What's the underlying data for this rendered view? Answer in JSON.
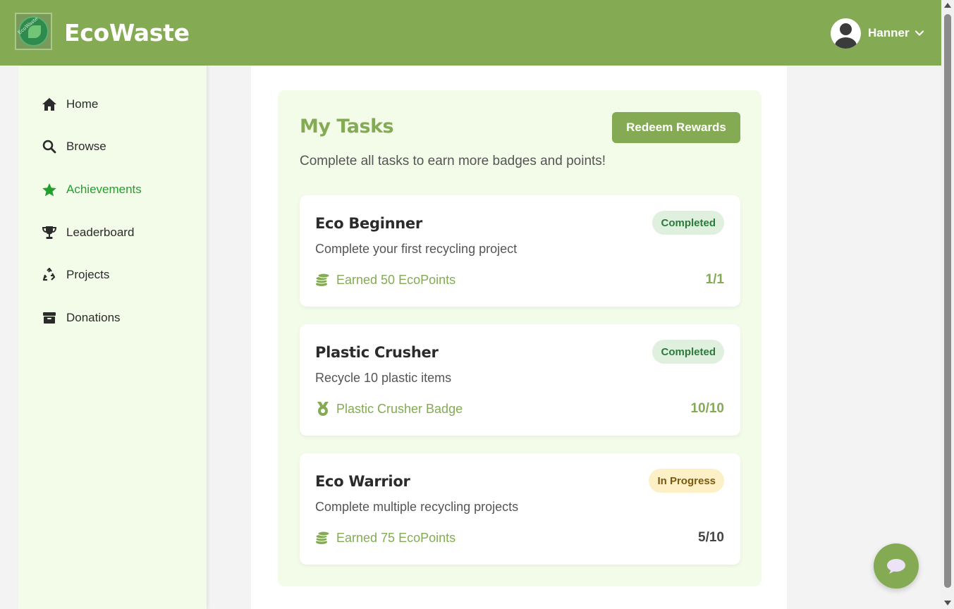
{
  "header": {
    "brand": "EcoWaste",
    "logo_text": "EcoWaste",
    "username": "Hanner"
  },
  "colors": {
    "primary": "#84ab54",
    "sidebar_bg": "#f3fce9",
    "active_nav": "#22a02e",
    "completed_badge_bg": "#dff0de",
    "progress_badge_bg": "#fdf0c6"
  },
  "sidebar": {
    "items": [
      {
        "label": "Home",
        "icon": "home-icon"
      },
      {
        "label": "Browse",
        "icon": "search-icon"
      },
      {
        "label": "Achievements",
        "icon": "star-icon",
        "active": true
      },
      {
        "label": "Leaderboard",
        "icon": "trophy-icon"
      },
      {
        "label": "Projects",
        "icon": "recycle-icon"
      },
      {
        "label": "Donations",
        "icon": "box-icon"
      }
    ]
  },
  "main": {
    "title": "My Tasks",
    "redeem_label": "Redeem Rewards",
    "subtitle": "Complete all tasks to earn more badges and points!",
    "tasks": [
      {
        "title": "Eco Beginner",
        "status": "Completed",
        "description": "Complete your first recycling project",
        "reward": "Earned 50 EcoPoints",
        "reward_icon": "coins-icon",
        "progress": "1/1"
      },
      {
        "title": "Plastic Crusher",
        "status": "Completed",
        "description": "Recycle 10 plastic items",
        "reward": "Plastic Crusher Badge",
        "reward_icon": "medal-icon",
        "progress": "10/10"
      },
      {
        "title": "Eco Warrior",
        "status": "In Progress",
        "description": "Complete multiple recycling projects",
        "reward": "Earned 75 EcoPoints",
        "reward_icon": "coins-icon",
        "progress": "5/10"
      }
    ]
  }
}
